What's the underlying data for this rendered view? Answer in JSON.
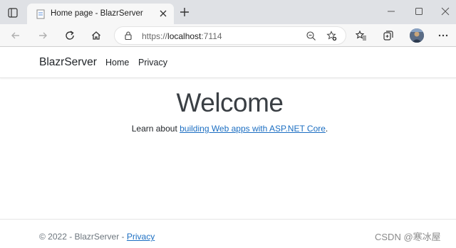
{
  "browser": {
    "tab": {
      "title": "Home page - BlazrServer"
    },
    "address": {
      "protocol": "https://",
      "host": "localhost",
      "port": ":7114"
    },
    "icons": [
      "window-menu-icon",
      "page-favicon-icon",
      "close-tab-icon",
      "new-tab-icon",
      "minimize-icon",
      "maximize-icon",
      "close-window-icon",
      "back-icon",
      "forward-icon",
      "refresh-icon",
      "home-icon",
      "lock-icon",
      "zoom-out-icon",
      "add-favorite-icon",
      "favorites-icon",
      "collections-icon",
      "more-icon"
    ]
  },
  "page": {
    "navbar": {
      "brand": "BlazrServer",
      "links": [
        {
          "label": "Home"
        },
        {
          "label": "Privacy"
        }
      ]
    },
    "main": {
      "heading": "Welcome",
      "learn_prefix": "Learn about ",
      "learn_link": "building Web apps with ASP.NET Core",
      "learn_suffix": "."
    },
    "footer": {
      "copyright": "© 2022 - BlazrServer - ",
      "privacy_link": "Privacy"
    }
  },
  "watermark": "CSDN @寒冰屋",
  "colors": {
    "link": "#1b6ec2",
    "chrome": "#dfe1e5",
    "toolbar": "#f7f7f7"
  }
}
